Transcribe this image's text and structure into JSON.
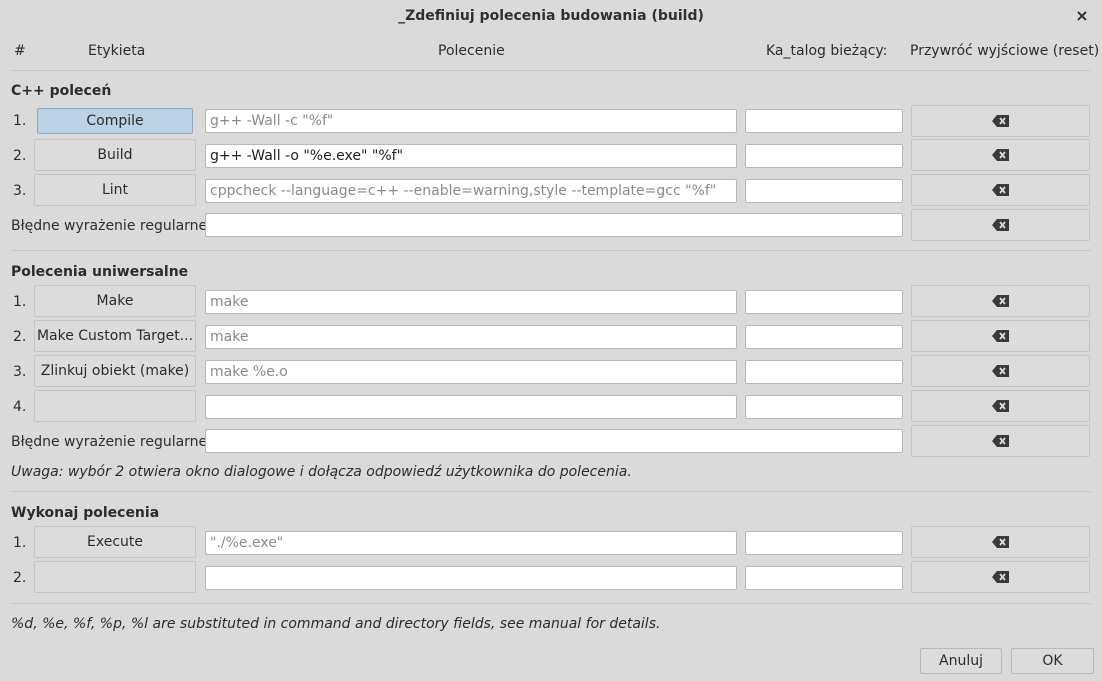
{
  "window": {
    "title": "_Zdefiniuj polecenia budowania (build)",
    "close_glyph": "×"
  },
  "header": {
    "num": "#",
    "label": "Etykieta",
    "command": "Polecenie",
    "dir": "Ka_talog bieżący:",
    "reset": "Przywróć wyjściowe (reset)"
  },
  "sections": {
    "cpp": {
      "title": "C++ poleceń",
      "rows": [
        {
          "num": "1.",
          "label": "Compile",
          "command": "g++ -Wall -c \"%f\"",
          "dir": ""
        },
        {
          "num": "2.",
          "label": "Build",
          "command": "g++ -Wall -o \"%e.exe\" \"%f\"",
          "dir": ""
        },
        {
          "num": "3.",
          "label": "Lint",
          "command": "cppcheck --language=c++ --enable=warning,style --template=gcc \"%f\"",
          "dir": ""
        }
      ],
      "regex_label": "Błędne wyrażenie regularne:",
      "regex_value": ""
    },
    "universal": {
      "title": "Polecenia uniwersalne",
      "rows": [
        {
          "num": "1.",
          "label": "Make",
          "command": "make",
          "dir": ""
        },
        {
          "num": "2.",
          "label": "Make Custom Target...",
          "command": "make",
          "dir": ""
        },
        {
          "num": "3.",
          "label": "Zlinkuj obiekt (make)",
          "command": "make %e.o",
          "dir": ""
        },
        {
          "num": "4.",
          "label": "",
          "command": "",
          "dir": ""
        }
      ],
      "regex_label": "Błędne wyrażenie regularne:",
      "regex_value": "",
      "note": "Uwaga: wybór 2 otwiera okno dialogowe i dołącza odpowiedź użytkownika do polecenia."
    },
    "execute": {
      "title": "Wykonaj polecenia",
      "rows": [
        {
          "num": "1.",
          "label": "Execute",
          "command": "\"./%e.exe\"",
          "dir": ""
        },
        {
          "num": "2.",
          "label": "",
          "command": "",
          "dir": ""
        }
      ]
    }
  },
  "footer_note": "%d, %e, %f, %p, %l are substituted in command and directory fields, see manual for details.",
  "buttons": {
    "cancel": "Anuluj",
    "ok": "OK"
  },
  "icons": {
    "reset": "clear-backspace-icon"
  },
  "colors": {
    "background": "#dadada",
    "active_button": "#bdd1e4"
  }
}
